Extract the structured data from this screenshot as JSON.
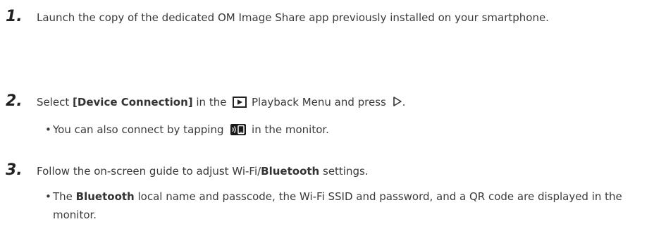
{
  "steps": [
    {
      "number": "1.",
      "text": "Launch the copy of the dedicated OM Image Share app previously installed on your smartphone."
    },
    {
      "number": "2.",
      "text_prefix": "Select ",
      "text_bold": "[Device Connection]",
      "text_mid": " in the ",
      "text_suffix": " Playback Menu and press ",
      "text_end": ".",
      "bullet": {
        "prefix": "You can also connect by tapping ",
        "suffix": " in the monitor."
      }
    },
    {
      "number": "3.",
      "text_prefix": "Follow the on-screen guide to adjust Wi-Fi/",
      "text_bold": "Bluetooth",
      "text_suffix": " settings.",
      "bullet": {
        "prefix": "The ",
        "bold": "Bluetooth",
        "suffix": " local name and passcode, the Wi-Fi SSID and password, and a QR code are displayed in the monitor."
      }
    }
  ],
  "icons": {
    "bullet_char": "•",
    "playback": "playback-icon",
    "right_arrow": "right-arrow-icon",
    "connect": "smartphone-connection-icon"
  }
}
